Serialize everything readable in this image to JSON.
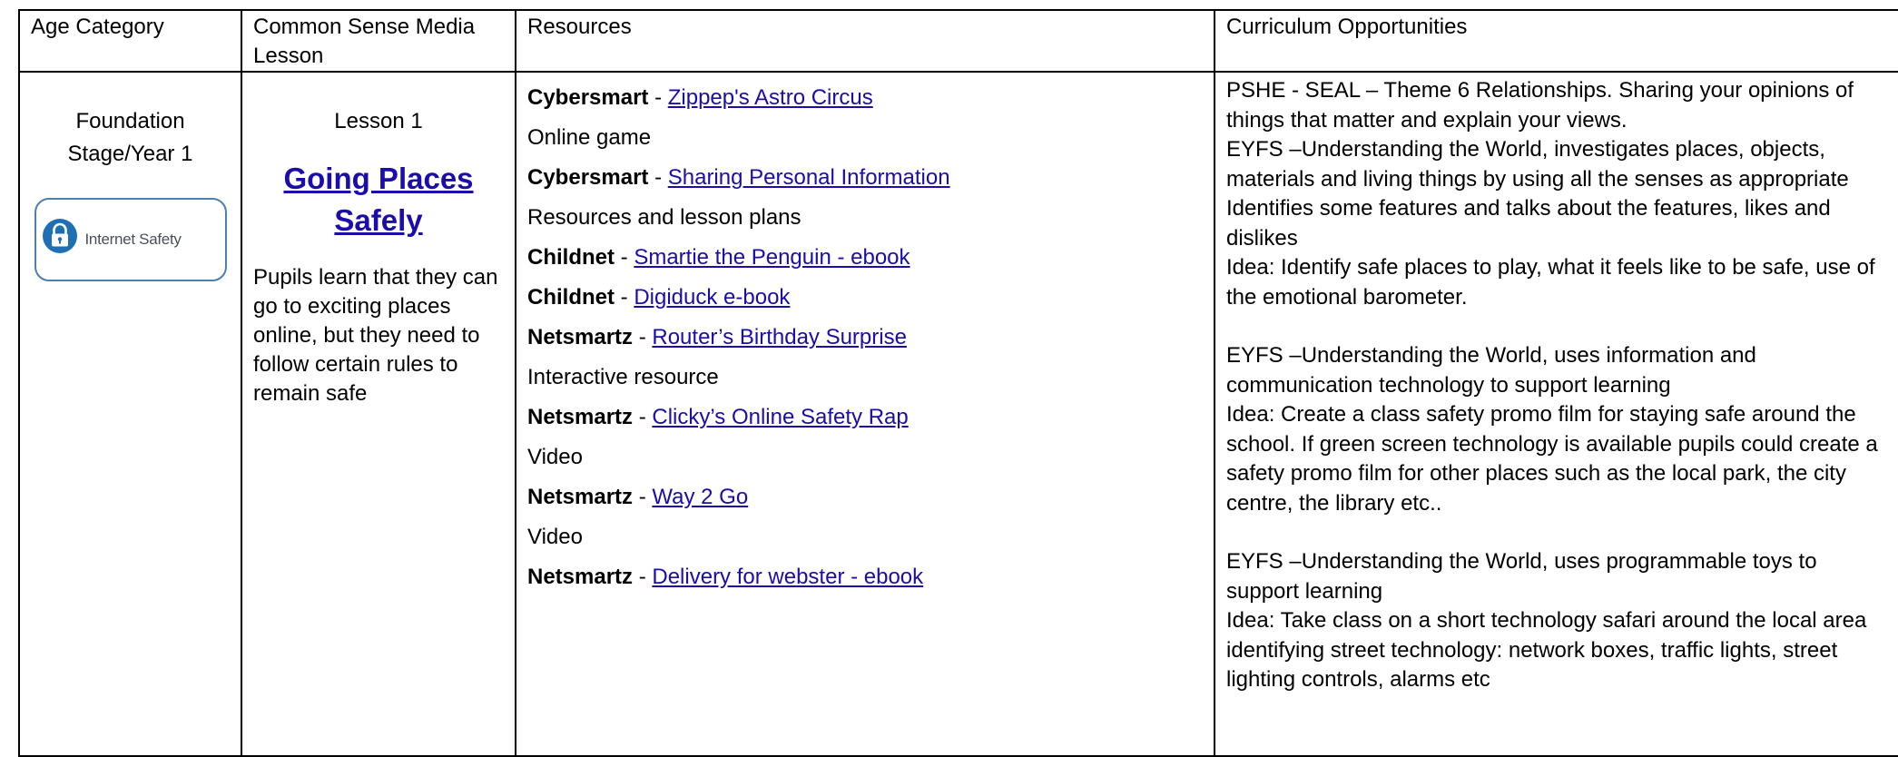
{
  "table": {
    "headers": {
      "age": "Age Category",
      "lesson": "Common Sense Media Lesson",
      "resources": "Resources",
      "curriculum": "Curriculum Opportunities"
    },
    "row": {
      "age": "Foundation Stage/Year 1",
      "badge": {
        "label": "Internet Safety",
        "icon": "padlock-icon",
        "accent": "#1f6fb5"
      },
      "lesson": {
        "number": "Lesson 1",
        "title": "Going Places Safely",
        "description": "Pupils learn that they can go to exciting places online, but they need to follow certain rules to remain safe"
      },
      "resources": [
        {
          "source": "Cybersmart",
          "link": "Zippep's Astro Circus"
        },
        {
          "note": "Online game"
        },
        {
          "source": "Cybersmart",
          "link": "Sharing Personal Information"
        },
        {
          "note": "Resources and lesson plans"
        },
        {
          "source": "Childnet",
          "link": "Smartie the Penguin - ebook"
        },
        {
          "source": "Childnet",
          "link": "Digiduck e-book"
        },
        {
          "source": "Netsmartz",
          "link": "Router’s Birthday Surprise"
        },
        {
          "note": "Interactive resource"
        },
        {
          "source": "Netsmartz",
          "link": "Clicky’s Online Safety Rap"
        },
        {
          "note": "Video"
        },
        {
          "source": "Netsmartz",
          "link": "Way 2 Go"
        },
        {
          "note": "Video"
        },
        {
          "source": "Netsmartz",
          "link": "Delivery for webster - ebook"
        }
      ],
      "curriculum": {
        "p1": "PSHE - SEAL – Theme 6 Relationships. Sharing your opinions of things that matter and explain your views.",
        "p2": "EYFS –Understanding the World, investigates places, objects, materials and living things by using all the senses as appropriate Identifies some features and talks about the features, likes and dislikes",
        "p3": "Idea: Identify safe places to play, what it feels like  to be safe, use of the emotional barometer.",
        "p4": "EYFS –Understanding the World, uses information and communication technology to support learning",
        "p5": "Idea: Create a class safety promo film for staying safe around the school.  If green screen technology is available pupils could create a safety promo film for other places such as the local park, the city centre, the library etc..",
        "p6": "EYFS –Understanding the World, uses programmable toys to support learning",
        "p7": "Idea: Take class on a short technology safari around the local area identifying street technology: network boxes, traffic lights, street lighting controls, alarms etc"
      }
    }
  }
}
